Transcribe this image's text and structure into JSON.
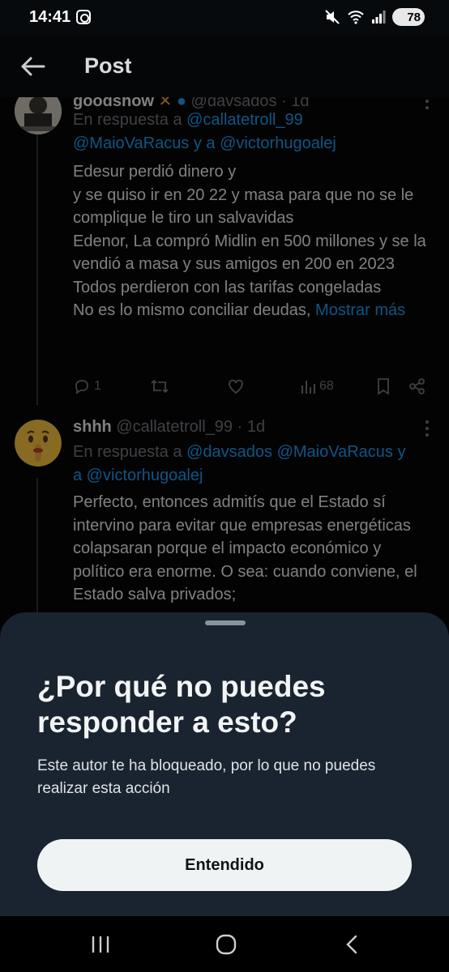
{
  "status_bar": {
    "time": "14:41",
    "battery": "78"
  },
  "app_bar": {
    "title": "Post"
  },
  "tweets": [
    {
      "name": "goodshow",
      "handle": "@davsados",
      "time": "1d",
      "reply_prefix": "En respuesta a",
      "reply_users_1": "@callatetroll_99",
      "reply_users_2": "@MaioVaRacus y a @victorhugoalej",
      "text": "Edesur perdió dinero y\ny se quiso ir en 20 22 y masa para que no se le complique le tiro un salvavidas\nEdenor, La compró Midlin en 500 millones y se la vendió a masa y sus amigos en 200 en 2023\nTodos perdieron con las tarifas congeladas\nNo es lo mismo conciliar deudas,",
      "show_more": "Mostrar más",
      "replies": "1",
      "views": "68"
    },
    {
      "name": "shhh",
      "handle": "@callatetroll_99",
      "time": "1d",
      "reply_prefix": "En respuesta a",
      "reply_users_1": "@davsados @MaioVaRacus y",
      "reply_users_2": "a @victorhugoalej",
      "text": "Perfecto, entonces admitís que el Estado sí intervino para evitar que empresas energéticas colapsaran porque el impacto económico y político era enorme. O sea: cuando conviene, el Estado salva privados;"
    }
  ],
  "sheet": {
    "title": "¿Por qué no puedes responder a esto?",
    "body": "Este autor te ha bloqueado, por lo que no puedes realizar esta acción",
    "button": "Entendido"
  },
  "colors": {
    "accent": "#1d9bf0",
    "sheet_bg": "#1a2430",
    "button_bg": "#eff3f4"
  }
}
